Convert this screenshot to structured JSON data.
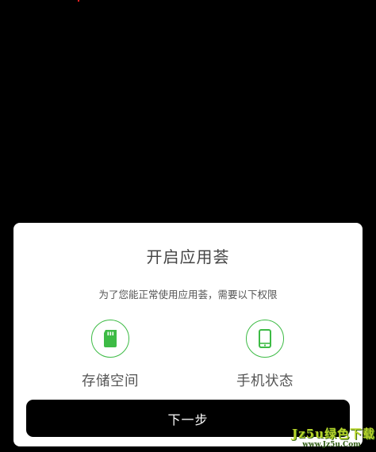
{
  "dialog": {
    "title": "开启应用荟",
    "subtitle": "为了您能正常使用应用荟，需要以下权限",
    "permissions": [
      {
        "label": "存储空间",
        "icon": "sd-card-icon"
      },
      {
        "label": "手机状态",
        "icon": "phone-icon"
      }
    ],
    "next_button_label": "下一步"
  },
  "watermark": {
    "main": "Jz5u绿色下载",
    "sub": "www.Jz5u.Com"
  },
  "colors": {
    "accent": "#3dbb45",
    "button_bg": "#000000",
    "dialog_bg": "#ffffff"
  }
}
